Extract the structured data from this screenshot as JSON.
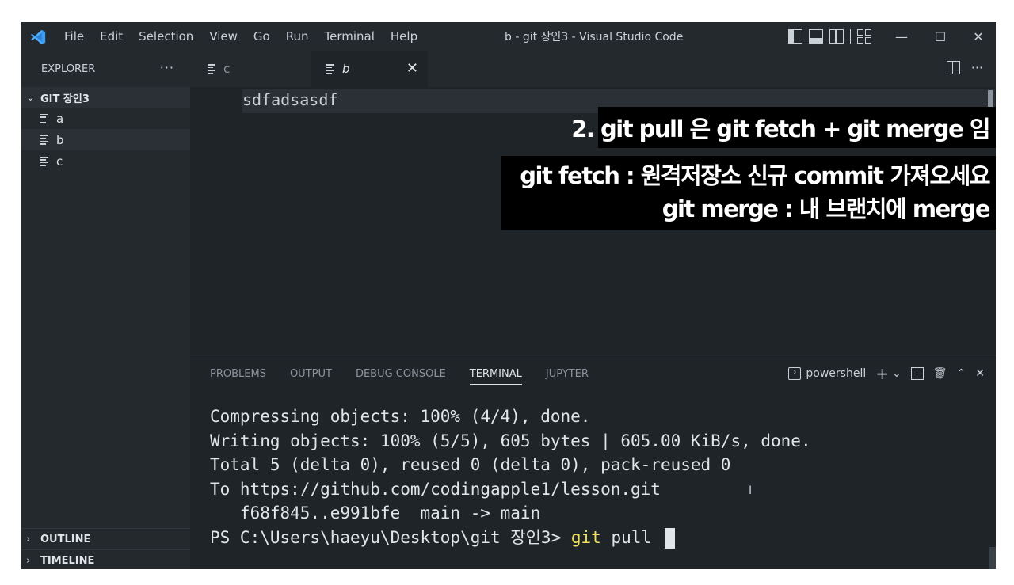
{
  "titlebar": {
    "menu": [
      "File",
      "Edit",
      "Selection",
      "View",
      "Go",
      "Run",
      "Terminal",
      "Help"
    ],
    "title": "b - git 장인3 - Visual Studio Code",
    "controls": {
      "minimize": "—",
      "maximize": "☐",
      "close": "✕"
    }
  },
  "sidebar": {
    "header": "EXPLORER",
    "more": "···",
    "folder": "GIT 장인3",
    "files": [
      "a",
      "b",
      "c"
    ],
    "outline": "OUTLINE",
    "timeline": "TIMELINE"
  },
  "tabs": {
    "inactive": "c",
    "active": "b",
    "close": "✕",
    "more": "···"
  },
  "editor": {
    "line1": "sdfadsasdf"
  },
  "overlay": {
    "line1": "2. git pull 은 git fetch + git merge 임",
    "line2": "git fetch : 원격저장소 신규 commit 가져오세요",
    "line3": "git merge : 내 브랜치에 merge"
  },
  "panel": {
    "tabs": [
      "PROBLEMS",
      "OUTPUT",
      "DEBUG CONSOLE",
      "TERMINAL",
      "JUPYTER"
    ],
    "shell": "powershell",
    "terminal": {
      "line1": "Compressing objects: 100% (4/4), done.",
      "line2": "Writing objects: 100% (5/5), 605 bytes | 605.00 KiB/s, done.",
      "line3": "Total 5 (delta 0), reused 0 (delta 0), pack-reused 0",
      "line4": "To https://github.com/codingapple1/lesson.git",
      "line5": "   f68f845..e991bfe  main -> main",
      "prompt": "PS C:\\Users\\haeyu\\Desktop\\git 장인3> ",
      "command": "git",
      "args": " pull "
    }
  },
  "colors": {
    "accent_blue": "#3b9cf2",
    "terminal_command": "#f1e05a"
  }
}
